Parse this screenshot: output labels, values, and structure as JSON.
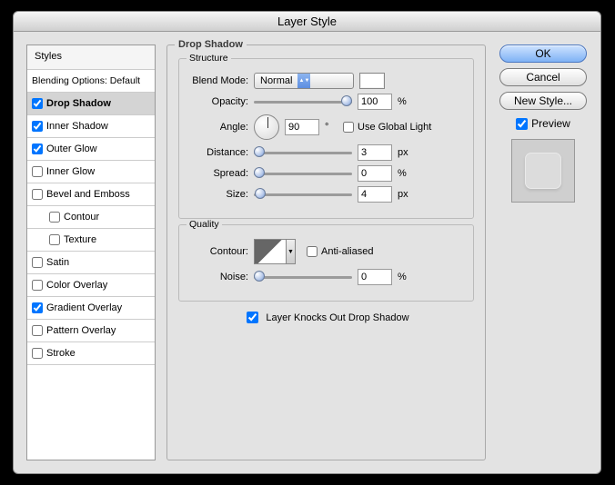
{
  "window": {
    "title": "Layer Style"
  },
  "sidebar": {
    "header": "Styles",
    "blending": "Blending Options: Default",
    "items": [
      {
        "label": "Drop Shadow",
        "checked": true,
        "selected": true,
        "indent": false
      },
      {
        "label": "Inner Shadow",
        "checked": true,
        "selected": false,
        "indent": false
      },
      {
        "label": "Outer Glow",
        "checked": true,
        "selected": false,
        "indent": false
      },
      {
        "label": "Inner Glow",
        "checked": false,
        "selected": false,
        "indent": false
      },
      {
        "label": "Bevel and Emboss",
        "checked": false,
        "selected": false,
        "indent": false
      },
      {
        "label": "Contour",
        "checked": false,
        "selected": false,
        "indent": true
      },
      {
        "label": "Texture",
        "checked": false,
        "selected": false,
        "indent": true
      },
      {
        "label": "Satin",
        "checked": false,
        "selected": false,
        "indent": false
      },
      {
        "label": "Color Overlay",
        "checked": false,
        "selected": false,
        "indent": false
      },
      {
        "label": "Gradient Overlay",
        "checked": true,
        "selected": false,
        "indent": false
      },
      {
        "label": "Pattern Overlay",
        "checked": false,
        "selected": false,
        "indent": false
      },
      {
        "label": "Stroke",
        "checked": false,
        "selected": false,
        "indent": false
      }
    ]
  },
  "panel": {
    "title": "Drop Shadow",
    "structure": {
      "title": "Structure",
      "blendModeLabel": "Blend Mode:",
      "blendModeValue": "Normal",
      "color": "#ffffff",
      "opacityLabel": "Opacity:",
      "opacityValue": "100",
      "opacityUnit": "%",
      "angleLabel": "Angle:",
      "angleValue": "90",
      "angleUnit": "°",
      "useGlobalLabel": "Use Global Light",
      "useGlobalChecked": false,
      "distanceLabel": "Distance:",
      "distanceValue": "3",
      "distanceUnit": "px",
      "spreadLabel": "Spread:",
      "spreadValue": "0",
      "spreadUnit": "%",
      "sizeLabel": "Size:",
      "sizeValue": "4",
      "sizeUnit": "px"
    },
    "quality": {
      "title": "Quality",
      "contourLabel": "Contour:",
      "antiAliasLabel": "Anti-aliased",
      "antiAliasChecked": false,
      "noiseLabel": "Noise:",
      "noiseValue": "0",
      "noiseUnit": "%"
    },
    "knockoutLabel": "Layer Knocks Out Drop Shadow",
    "knockoutChecked": true
  },
  "buttons": {
    "ok": "OK",
    "cancel": "Cancel",
    "newStyle": "New Style...",
    "previewLabel": "Preview",
    "previewChecked": true
  }
}
